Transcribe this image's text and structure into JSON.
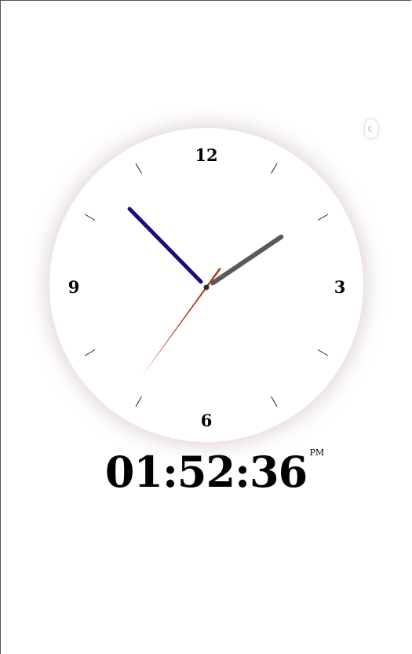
{
  "clock": {
    "numerals": {
      "twelve": "12",
      "three": "3",
      "six": "6",
      "nine": "9"
    },
    "hours": 1,
    "minutes": 52,
    "seconds": 36,
    "hand_colors": {
      "hour": "#5a5a5a",
      "minute": "#1e0a7a",
      "second": "#b0380f",
      "center": "#3a2a2a"
    },
    "face_glow_color": "#af8c91"
  },
  "digital": {
    "time": "01:52:36",
    "meridiem": "PM"
  },
  "theme_toggle": {
    "icon": "crescent-moon-icon",
    "glyph": "☾"
  }
}
